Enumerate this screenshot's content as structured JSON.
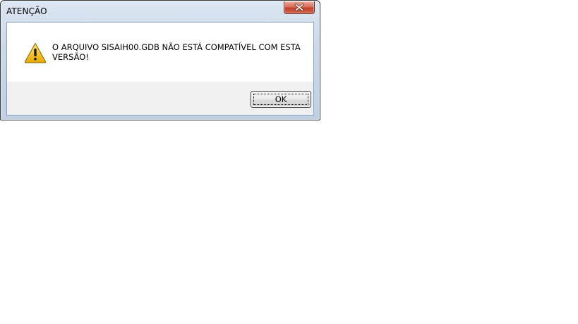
{
  "dialog": {
    "title": "ATENÇÃO",
    "message": "O ARQUIVO SISAIH00.GDB NÃO ESTÁ COMPATÍVEL COM ESTA VERSÃO!",
    "icon": "warning-icon",
    "ok_label": "OK",
    "close_icon": "close-icon",
    "colors": {
      "close_button": "#c7432d",
      "warning_fill": "#f6c400",
      "frame": "#c9d8ea"
    }
  }
}
